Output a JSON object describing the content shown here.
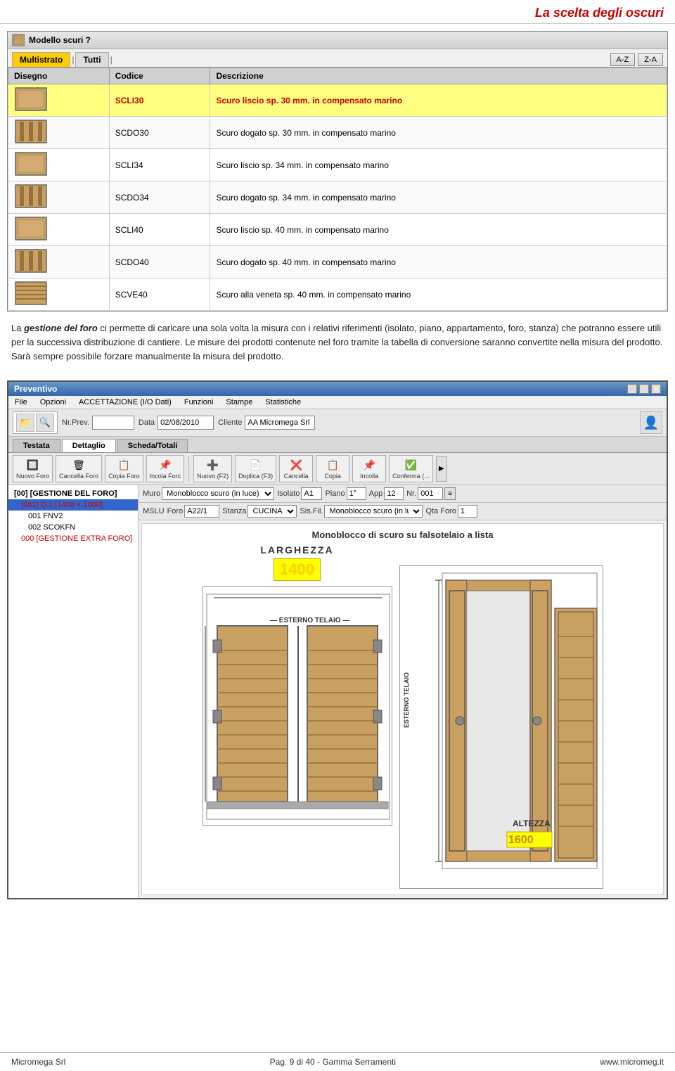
{
  "header": {
    "title": "La scelta degli oscuri"
  },
  "window": {
    "title": "Modello scuri ?",
    "tabs": [
      {
        "label": "Multistrato",
        "active": true
      },
      {
        "label": "Tutti",
        "active": false
      }
    ],
    "sort_buttons": [
      "A-Z",
      "Z-A"
    ],
    "columns": [
      "Disegno",
      "Codice",
      "Descrizione"
    ],
    "rows": [
      {
        "code": "SCLI30",
        "description": "Scuro liscio sp. 30 mm. in compensato marino",
        "highlight": true,
        "type": "smooth"
      },
      {
        "code": "SCDO30",
        "description": "Scuro dogato sp. 30 mm. in compensato marino",
        "highlight": false,
        "type": "grooved"
      },
      {
        "code": "SCLI34",
        "description": "Scuro liscio sp. 34 mm. in compensato marino",
        "highlight": false,
        "type": "smooth"
      },
      {
        "code": "SCDO34",
        "description": "Scuro dogato sp. 34 mm. in compensato marino",
        "highlight": false,
        "type": "grooved"
      },
      {
        "code": "SCLI40",
        "description": "Scuro liscio sp. 40 mm. in compensato marino",
        "highlight": false,
        "type": "smooth"
      },
      {
        "code": "SCDO40",
        "description": "Scuro dogato sp. 40 mm. in compensato marino",
        "highlight": false,
        "type": "grooved"
      },
      {
        "code": "SCVE40",
        "description": "Scuro alla veneta sp. 40 mm. in compensato marino",
        "highlight": false,
        "type": "veneta"
      }
    ]
  },
  "body_text": {
    "paragraph1": "La gestione del foro ci permette di caricare una sola volta la misura con i relativi riferimenti (isolato, piano, appartamento, foro, stanza) che potranno essere utili per la successiva distribuzione di cantiere. Le misure dei prodotti contenute nel foro tramite la tabella di conversione saranno convertite nella misura del prodotto. Sarà sempre possibile forzare manualmente la misura del prodotto.",
    "bold_italic_parts": [
      "gestione del foro"
    ]
  },
  "preventivo": {
    "title": "Preventivo",
    "menu_items": [
      "File",
      "Opzioni",
      "ACCETTAZIONE (I/O Dati)",
      "Funzioni",
      "Stampe",
      "Statistiche"
    ],
    "toolbar": {
      "nr_prev_label": "Nr.Prev.",
      "data_label": "Data",
      "data_value": "02/08/2010",
      "cliente_label": "Cliente",
      "cliente_value": "AA Micromega Srl"
    },
    "tabs": [
      "Testata",
      "Dettaglio",
      "Scheda/Totali"
    ],
    "active_tab": "Dettaglio",
    "action_buttons": [
      "Nuovo Foro",
      "Cancella Foro",
      "Copia Foro",
      "Incola Forc",
      "Nuovo (F2)",
      "Duplica (F3)",
      "Cancella",
      "Copia",
      "Incolla",
      "Conferma (..."
    ],
    "tree": {
      "items": [
        {
          "label": "[00] [GESTIONE DEL FORO]",
          "level": 1,
          "selected": false
        },
        {
          "label": "[001] Q.1 [1400 × 1600]",
          "level": 2,
          "selected": true
        },
        {
          "label": "001  FNV2",
          "level": 3,
          "selected": false
        },
        {
          "label": "002  SCOKFN",
          "level": 3,
          "selected": false
        },
        {
          "label": "000 [GESTIONE EXTRA FORO]",
          "level": 2,
          "selected": false
        }
      ]
    },
    "form": {
      "muro_label": "Muro",
      "muro_value": "Monoblocco scuro (in luce)",
      "isolato_label": "Isolato",
      "isolato_value": "A1",
      "piano_label": "Piano",
      "piano_value": "1°",
      "app_label": "App",
      "app_value": "12",
      "nr_label": "Nr.",
      "nr_value": "001",
      "foro_label": "Foro",
      "foro_value": "A22/1",
      "stanza_label": "Stanza",
      "stanza_value": "CUCINA",
      "qta_foro_label": "Qta Foro",
      "qta_foro_value": "1",
      "sisfil_label": "Sis.Fil.",
      "sisfil_value": "Monoblocco scuro (in luce)",
      "mslu_label": "MSLU"
    },
    "drawing": {
      "title": "Monoblocco di scuro su falsotelaio a lista",
      "larghezza_label": "LARGHEZZA",
      "larghezza_value": "1400",
      "altezza_label": "ALTEZZA",
      "altezza_value": "1600",
      "esterno_telaio_label": "ESTERNO TELAIO"
    }
  },
  "footer": {
    "company": "Micromega Srl",
    "page": "Pag. 9 di 40 - Gamma Serramenti",
    "website": "www.micromeg.it"
  }
}
